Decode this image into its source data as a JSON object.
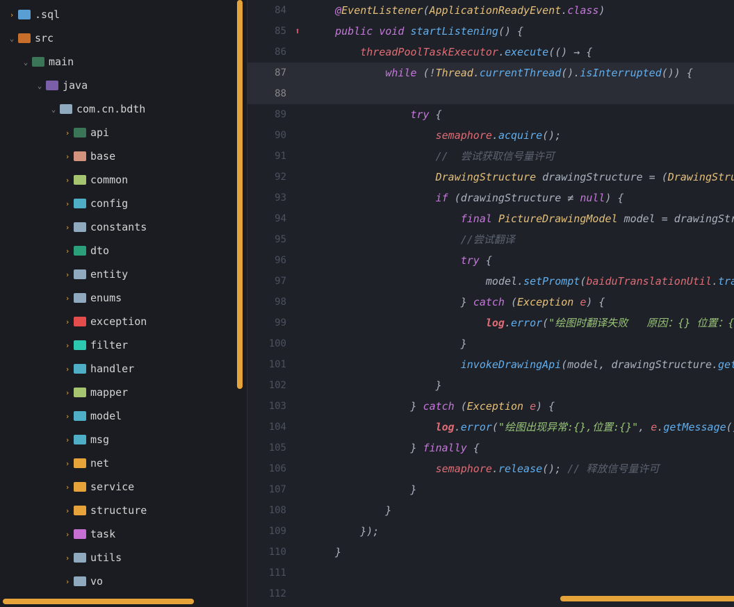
{
  "tree": [
    {
      "indent": 0,
      "chev": "collapsed",
      "icon": "ic-sql",
      "label": ".sql"
    },
    {
      "indent": 0,
      "chev": "expanded",
      "icon": "ic-src",
      "label": "src"
    },
    {
      "indent": 1,
      "chev": "expanded",
      "icon": "ic-main",
      "label": "main"
    },
    {
      "indent": 2,
      "chev": "expanded",
      "icon": "ic-java",
      "label": "java"
    },
    {
      "indent": 3,
      "chev": "expanded",
      "icon": "ic-pkg",
      "label": "com.cn.bdth"
    },
    {
      "indent": 4,
      "chev": "collapsed",
      "icon": "ic-api",
      "label": "api"
    },
    {
      "indent": 4,
      "chev": "collapsed",
      "icon": "ic-base",
      "label": "base"
    },
    {
      "indent": 4,
      "chev": "collapsed",
      "icon": "ic-common",
      "label": "common"
    },
    {
      "indent": 4,
      "chev": "collapsed",
      "icon": "ic-config",
      "label": "config"
    },
    {
      "indent": 4,
      "chev": "collapsed",
      "icon": "ic-constants",
      "label": "constants"
    },
    {
      "indent": 4,
      "chev": "collapsed",
      "icon": "ic-dto",
      "label": "dto"
    },
    {
      "indent": 4,
      "chev": "collapsed",
      "icon": "ic-entity",
      "label": "entity"
    },
    {
      "indent": 4,
      "chev": "collapsed",
      "icon": "ic-enums",
      "label": "enums"
    },
    {
      "indent": 4,
      "chev": "collapsed",
      "icon": "ic-exception",
      "label": "exception"
    },
    {
      "indent": 4,
      "chev": "collapsed",
      "icon": "ic-filter",
      "label": "filter"
    },
    {
      "indent": 4,
      "chev": "collapsed",
      "icon": "ic-handler",
      "label": "handler"
    },
    {
      "indent": 4,
      "chev": "collapsed",
      "icon": "ic-mapper",
      "label": "mapper"
    },
    {
      "indent": 4,
      "chev": "collapsed",
      "icon": "ic-model",
      "label": "model"
    },
    {
      "indent": 4,
      "chev": "collapsed",
      "icon": "ic-msg",
      "label": "msg"
    },
    {
      "indent": 4,
      "chev": "collapsed",
      "icon": "ic-net",
      "label": "net"
    },
    {
      "indent": 4,
      "chev": "collapsed",
      "icon": "ic-service",
      "label": "service"
    },
    {
      "indent": 4,
      "chev": "collapsed",
      "icon": "ic-structure",
      "label": "structure"
    },
    {
      "indent": 4,
      "chev": "collapsed",
      "icon": "ic-task",
      "label": "task"
    },
    {
      "indent": 4,
      "chev": "collapsed",
      "icon": "ic-utils",
      "label": "utils"
    },
    {
      "indent": 4,
      "chev": "collapsed",
      "icon": "ic-vo",
      "label": "vo"
    }
  ],
  "lines": {
    "start": 84,
    "hl": 88,
    "marker": 85
  },
  "code": {
    "l84_pre": "    ",
    "l84_at": "@",
    "l84_ann": "EventListener",
    "l84_op": "(",
    "l84_cls": "ApplicationReadyEvent",
    "l84_dot": ".",
    "l84_kw": "class",
    "l84_cl": ")",
    "l85_pre": "    ",
    "l85_pub": "public ",
    "l85_void": "void ",
    "l85_name": "startListening",
    "l85_par": "() {",
    "l86_pre": "        ",
    "l86_fld": "threadPoolTaskExecutor",
    "l86_dot": ".",
    "l86_m": "execute",
    "l86_par": "(() → {",
    "l87_pre": "            ",
    "l87_while": "while ",
    "l87_op": "(!",
    "l87_cls": "Thread",
    "l87_dot": ".",
    "l87_m1": "currentThread",
    "l87_p1": "().",
    "l87_m2": "isInterrupted",
    "l87_p2": "()) {",
    "l89_pre": "                ",
    "l89_try": "try ",
    "l89_b": "{",
    "l90_pre": "                    ",
    "l90_fld": "semaphore",
    "l90_dot": ".",
    "l90_m": "acquire",
    "l90_p": "();",
    "l91_pre": "                    ",
    "l91_c": "//  尝试获取信号量许可",
    "l92_pre": "                    ",
    "l92_cls": "DrawingStructure ",
    "l92_var": "drawingStructure = (",
    "l92_cls2": "DrawingStru",
    "l93_pre": "                    ",
    "l93_if": "if ",
    "l93_op": "(drawingStructure ≠ ",
    "l93_null": "null",
    "l93_cl": ") {",
    "l94_pre": "                        ",
    "l94_fin": "final ",
    "l94_cls": "PictureDrawingModel ",
    "l94_var": "model = drawingStr",
    "l95_pre": "                        ",
    "l95_c": "//尝试翻译",
    "l96_pre": "                        ",
    "l96_try": "try ",
    "l96_b": "{",
    "l97_pre": "                            ",
    "l97_var": "model.",
    "l97_m": "setPrompt",
    "l97_op": "(",
    "l97_fld": "baiduTranslationUtil",
    "l97_dot": ".",
    "l97_m2": "tra",
    "l98_pre": "                        } ",
    "l98_catch": "catch ",
    "l98_op": "(",
    "l98_cls": "Exception ",
    "l98_var": "e",
    "l98_cl": ") {",
    "l99_pre": "                            ",
    "l99_log": "log",
    "l99_dot": ".",
    "l99_m": "error",
    "l99_op": "(",
    "l99_str": "\"绘图时翻译失败   原因：{} 位置：{}\"",
    "l100_pre": "                        }",
    "l101_pre": "                        ",
    "l101_m": "invokeDrawingApi",
    "l101_op": "(model, drawingStructure.",
    "l101_m2": "get",
    "l102_pre": "                    }",
    "l103_pre": "                } ",
    "l103_catch": "catch ",
    "l103_op": "(",
    "l103_cls": "Exception ",
    "l103_var": "e",
    "l103_cl": ") {",
    "l104_pre": "                    ",
    "l104_log": "log",
    "l104_dot": ".",
    "l104_m": "error",
    "l104_op": "(",
    "l104_str": "\"绘图出现异常:{},位置:{}\"",
    "l104_c": ", ",
    "l104_var": "e",
    "l104_dot2": ".",
    "l104_m2": "getMessage",
    "l104_p": "()",
    "l105_pre": "                } ",
    "l105_fin": "finally ",
    "l105_b": "{",
    "l106_pre": "                    ",
    "l106_fld": "semaphore",
    "l106_dot": ".",
    "l106_m": "release",
    "l106_p": "(); ",
    "l106_c": "// 释放信号量许可",
    "l107_pre": "                }",
    "l108_pre": "            }",
    "l109_pre": "        });",
    "l110_pre": "    }"
  }
}
